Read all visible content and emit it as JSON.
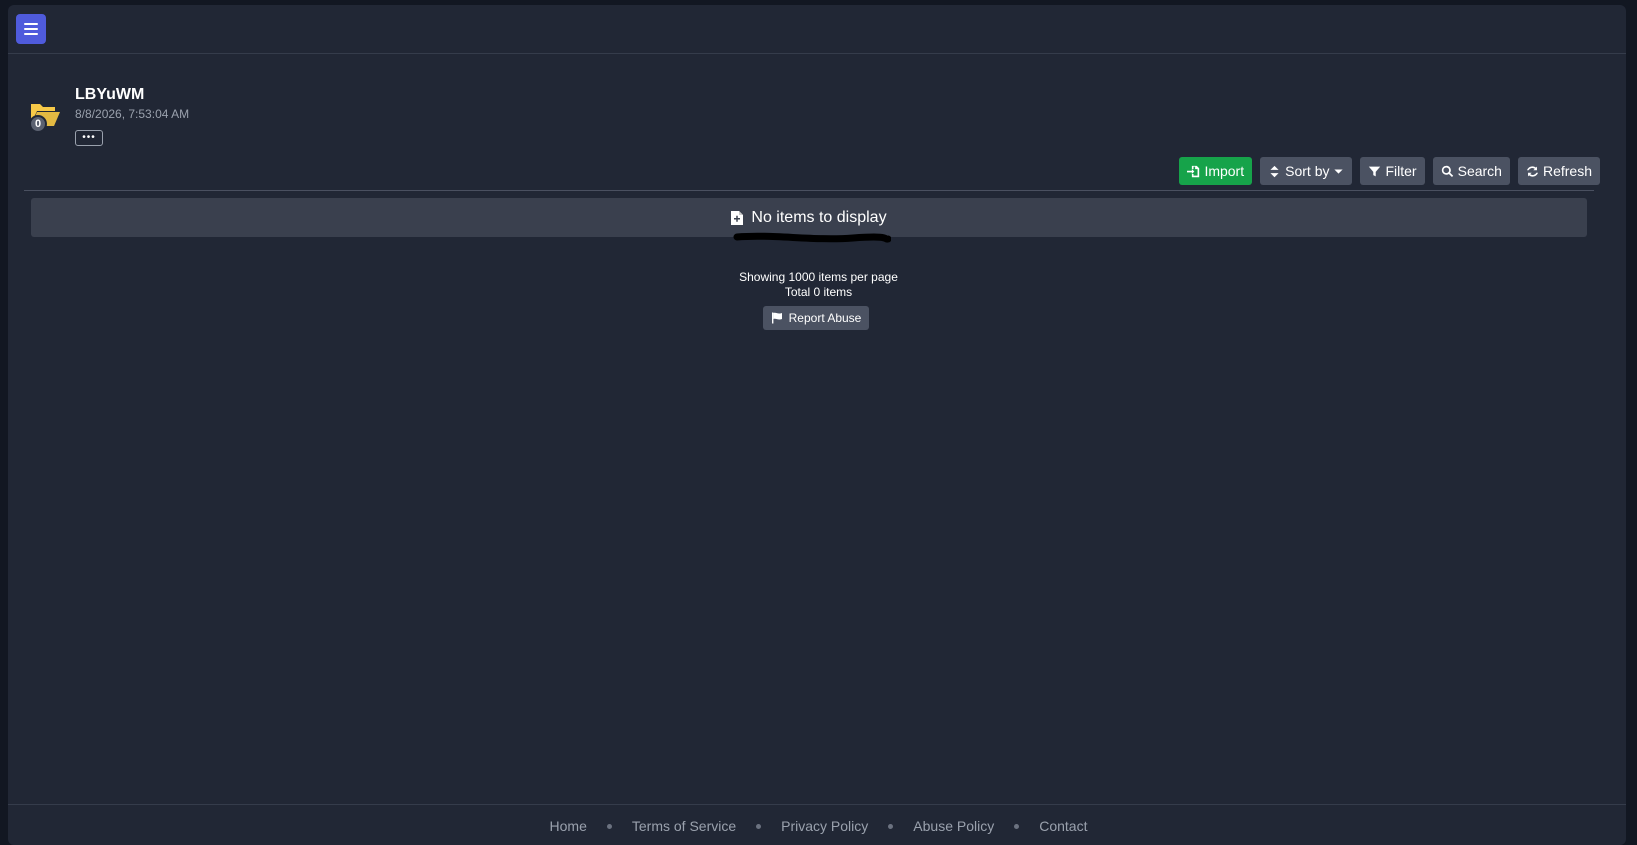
{
  "folder": {
    "title": "LBYuWM",
    "date": "8/8/2026, 7:53:04 AM",
    "item_count_badge": "0",
    "more_label": "•••",
    "folder_color": "#f7c948"
  },
  "toolbar": {
    "import_label": "Import",
    "sort_label": "Sort by",
    "filter_label": "Filter",
    "search_label": "Search",
    "refresh_label": "Refresh",
    "import_color": "#16a34a"
  },
  "content": {
    "empty_message": "No items to display",
    "per_page_text": "Showing 1000 items per page",
    "total_text": "Total 0 items",
    "report_label": "Report Abuse"
  },
  "footer": {
    "links": [
      "Home",
      "Terms of Service",
      "Privacy Policy",
      "Abuse Policy",
      "Contact"
    ]
  },
  "colors": {
    "background": "#212735",
    "menu_button": "#4f5bdc"
  }
}
